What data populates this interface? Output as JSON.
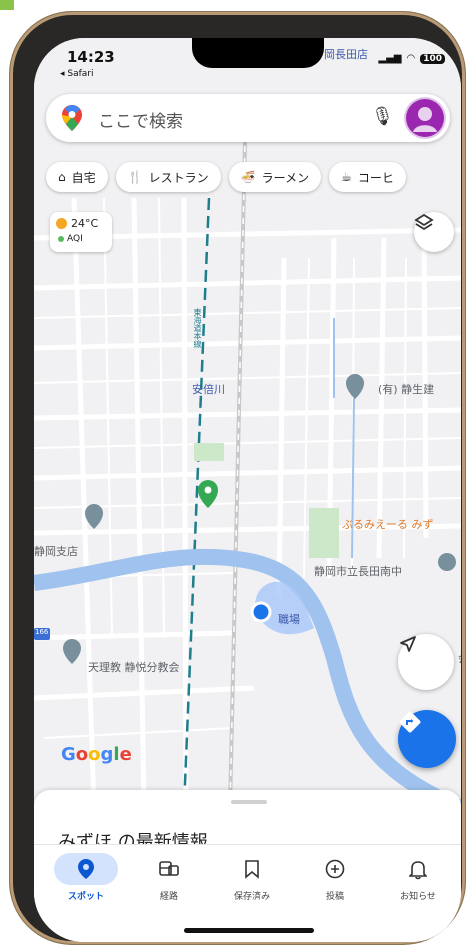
{
  "status": {
    "time": "14:23",
    "back_app": "Safari",
    "battery": "100"
  },
  "search": {
    "placeholder": "ここで検索"
  },
  "chips": [
    {
      "icon": "home-icon",
      "label": "自宅"
    },
    {
      "icon": "restaurant-icon",
      "label": "レストラン"
    },
    {
      "icon": "ramen-icon",
      "label": "ラーメン"
    },
    {
      "icon": "coffee-icon",
      "label": "コーヒ"
    }
  ],
  "weather": {
    "temp": "24°C",
    "aqi": "AQI"
  },
  "map_labels": {
    "top_place": "岡長田店",
    "station": "安倍川",
    "place_right": "(有) 静生建",
    "branch": "静岡支店",
    "orange_place": "ぶるみえーる みず",
    "school": "静岡市立長田南中",
    "current": "職場",
    "church": "天理教 静悦分教会",
    "church_suffix": "会",
    "rail_line": "東海道本線",
    "route_badge": "166"
  },
  "brand": {
    "google": "Google"
  },
  "sheet": {
    "title": "みずほ の最新情報"
  },
  "nav": [
    {
      "icon": "pin-icon",
      "label": "スポット",
      "active": true
    },
    {
      "icon": "transit-icon",
      "label": "経路",
      "active": false
    },
    {
      "icon": "bookmark-icon",
      "label": "保存済み",
      "active": false
    },
    {
      "icon": "plus-circle-icon",
      "label": "投稿",
      "active": false
    },
    {
      "icon": "bell-icon",
      "label": "お知らせ",
      "active": false
    }
  ],
  "colors": {
    "accent": "#1a73e8",
    "river": "#9fc3ee",
    "avatar": "#9b27b0",
    "frame": "#b89b74"
  }
}
